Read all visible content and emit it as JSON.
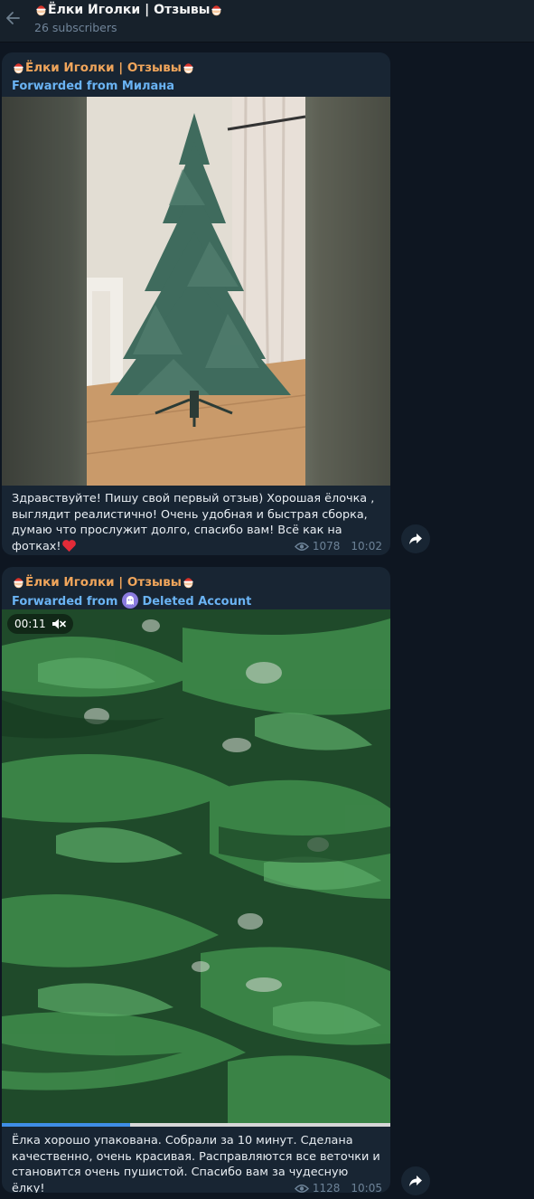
{
  "header": {
    "title": "Ёлки Иголки | Отзывы",
    "subscribers": "26 subscribers"
  },
  "messages": [
    {
      "channel": "Ёлки Иголки | Отзывы",
      "forwarded_prefix": "Forwarded from",
      "forwarded_name": "Милана",
      "caption": "Здравствуйте! Пишу свой первый отзыв) Хорошая ёлочка , выглядит реалистично! Очень удобная и быстрая сборка, думаю что прослужит долго, спасибо вам! Всё как на фотках!",
      "views": "1078",
      "time": "10:02"
    },
    {
      "channel": "Ёлки Иголки | Отзывы",
      "forwarded_prefix": "Forwarded from",
      "forwarded_name": "Deleted Account",
      "video_duration": "00:11",
      "video_progress": 0.33,
      "caption": "Ёлка хорошо упакована. Собрали за 10 минут. Сделана качественно, очень красивая. Расправляются все веточки и становится очень пушистой. Спасибо вам за чудесную ёлку!",
      "views": "1128",
      "time": "10:05"
    }
  ],
  "colors": {
    "background": "#0e1621",
    "header": "#17212b",
    "bubble": "#182533",
    "channel_name": "#f0a55b",
    "forward_link": "#6ab3f3",
    "meta": "#6d8398"
  },
  "icons": [
    "back-arrow-icon",
    "santa-emoji-icon",
    "heart-emoji-icon",
    "eye-icon",
    "share-icon",
    "mute-icon",
    "ghost-avatar-icon"
  ]
}
